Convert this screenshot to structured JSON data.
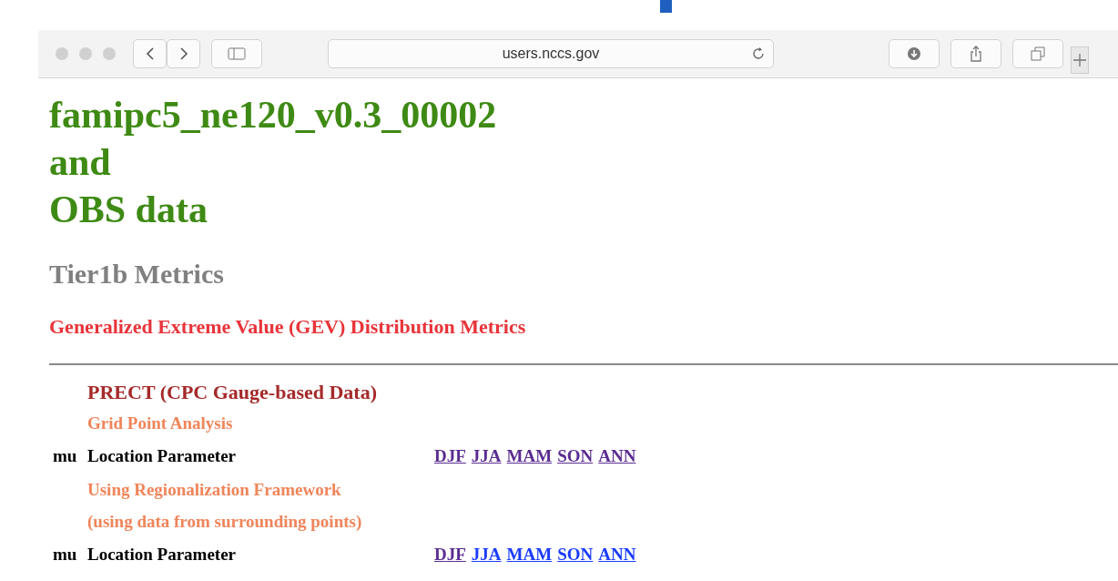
{
  "browser": {
    "address": "users.nccs.gov"
  },
  "page": {
    "title_lines": [
      "famipc5_ne120_v0.3_00002",
      "and",
      "OBS data"
    ],
    "subtitle": "Tier1b Metrics",
    "section": "Generalized Extreme Value (GEV) Distribution Metrics",
    "variable": "PRECT (CPC Gauge-based Data)",
    "groups": [
      {
        "headings": [
          "Grid Point Analysis"
        ],
        "rows": [
          {
            "symbol": "mu",
            "label": "Location Parameter",
            "links": [
              {
                "text": "DJF",
                "visited": true
              },
              {
                "text": "JJA",
                "visited": true
              },
              {
                "text": "MAM",
                "visited": true
              },
              {
                "text": "SON",
                "visited": true
              },
              {
                "text": "ANN",
                "visited": true
              }
            ]
          }
        ]
      },
      {
        "headings": [
          "Using Regionalization Framework",
          "(using data from surrounding points)"
        ],
        "rows": [
          {
            "symbol": "mu",
            "label": "Location Parameter",
            "links": [
              {
                "text": "DJF",
                "visited": true
              },
              {
                "text": "JJA",
                "visited": false
              },
              {
                "text": "MAM",
                "visited": false
              },
              {
                "text": "SON",
                "visited": false
              },
              {
                "text": "ANN",
                "visited": false
              }
            ]
          }
        ]
      }
    ]
  }
}
